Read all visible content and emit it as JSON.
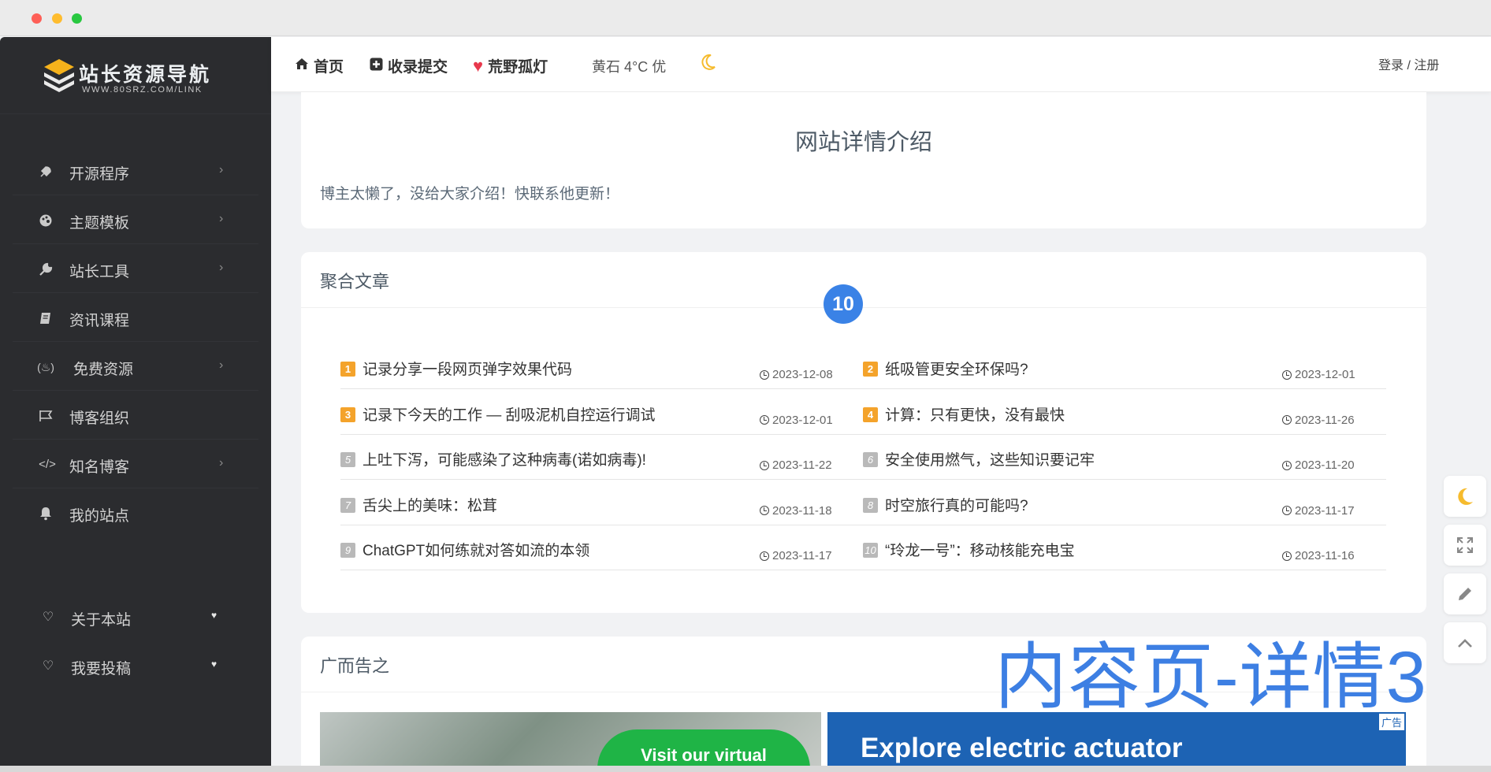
{
  "sidebar": {
    "logo_text": "站长资源导航",
    "logo_sub": "WWW.80SRZ.COM/LINK",
    "items": [
      {
        "label": "开源程序",
        "icon": "rocket-icon",
        "has_arrow": true
      },
      {
        "label": "主题模板",
        "icon": "palette-icon",
        "has_arrow": true
      },
      {
        "label": "站长工具",
        "icon": "wrench-icon",
        "has_arrow": true
      },
      {
        "label": "资讯课程",
        "icon": "book-icon",
        "has_arrow": false
      },
      {
        "label": "免费资源",
        "icon": "fire-icon",
        "has_arrow": true
      },
      {
        "label": "博客组织",
        "icon": "flag-icon",
        "has_arrow": false
      },
      {
        "label": "知名博客",
        "icon": "code-icon",
        "has_arrow": true
      },
      {
        "label": "我的站点",
        "icon": "bell-icon",
        "has_arrow": false
      }
    ],
    "bottom_items": [
      {
        "label": "关于本站",
        "icon": "heart-outline-icon"
      },
      {
        "label": "我要投稿",
        "icon": "heart-outline-icon"
      }
    ]
  },
  "topnav": {
    "home": "首页",
    "submit": "收录提交",
    "lamp": "荒野孤灯",
    "weather": "黄石 4°C 优",
    "login": "登录 / 注册"
  },
  "detail": {
    "title": "网站详情介绍",
    "desc": "博主太懒了，没给大家介绍！快联系他更新！"
  },
  "articles": {
    "heading": "聚合文章",
    "badge": "10",
    "items": [
      {
        "num": "1",
        "title": "记录分享一段网页弹字效果代码",
        "date": "2023-12-08"
      },
      {
        "num": "2",
        "title": "纸吸管更安全环保吗?",
        "date": "2023-12-01"
      },
      {
        "num": "3",
        "title": "记录下今天的工作 — 刮吸泥机自控运行调试",
        "date": "2023-12-01"
      },
      {
        "num": "4",
        "title": "计算：只有更快，没有最快",
        "date": "2023-11-26"
      },
      {
        "num": "5",
        "title": "上吐下泻，可能感染了这种病毒(诺如病毒)!",
        "date": "2023-11-22"
      },
      {
        "num": "6",
        "title": "安全使用燃气，这些知识要记牢",
        "date": "2023-11-20"
      },
      {
        "num": "7",
        "title": "舌尖上的美味：松茸",
        "date": "2023-11-18"
      },
      {
        "num": "8",
        "title": "时空旅行真的可能吗?",
        "date": "2023-11-17"
      },
      {
        "num": "9",
        "title": "ChatGPT如何练就对答如流的本领",
        "date": "2023-11-17"
      },
      {
        "num": "10",
        "title": "“玲龙一号”：移动核能充电宝",
        "date": "2023-11-16"
      }
    ]
  },
  "ads": {
    "heading": "广而告之",
    "left_cta": "Visit our virtual showroom",
    "right_text": "Explore electric actuator",
    "ad_mark": "广告"
  },
  "overlay_text": "内容页-详情3",
  "colors": {
    "accent_blue": "#3a82e6",
    "hot_badge": "#f4a32b",
    "sidebar_bg": "#2b2c2f"
  }
}
